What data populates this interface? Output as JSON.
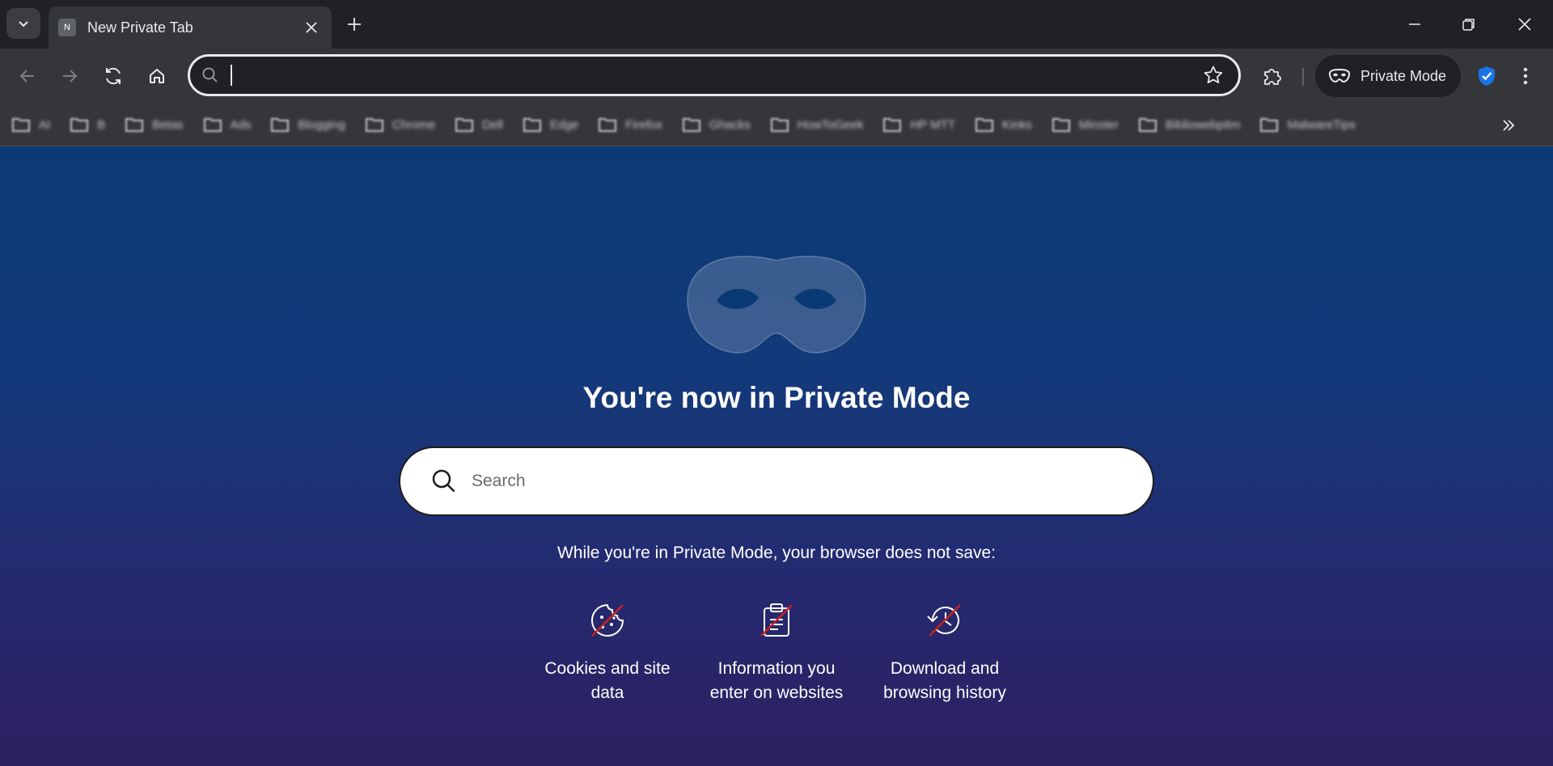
{
  "tab": {
    "favicon_letter": "N",
    "title": "New Private Tab"
  },
  "omnibox": {
    "value": "",
    "placeholder": ""
  },
  "toolbar": {
    "private_mode_label": "Private Mode"
  },
  "bookmarks": [
    {
      "label": "AI"
    },
    {
      "label": "B"
    },
    {
      "label": "Betas"
    },
    {
      "label": "Ads"
    },
    {
      "label": "Blogging"
    },
    {
      "label": "Chrome"
    },
    {
      "label": "Dell"
    },
    {
      "label": "Edge"
    },
    {
      "label": "Firefox"
    },
    {
      "label": "Ghacks"
    },
    {
      "label": "HowToGeek"
    },
    {
      "label": "HP MTT"
    },
    {
      "label": "Kinks"
    },
    {
      "label": "Minster"
    },
    {
      "label": "Bibliowebpitm"
    },
    {
      "label": "MalwareTips"
    }
  ],
  "main": {
    "headline": "You're now in Private Mode",
    "search_placeholder": "Search",
    "subtext": "While you're in Private Mode, your browser does not save:",
    "features": [
      {
        "icon": "cookie-crossed-icon",
        "line1": "Cookies and site",
        "line2": "data"
      },
      {
        "icon": "clipboard-crossed-icon",
        "line1": "Information you",
        "line2": "enter on websites"
      },
      {
        "icon": "history-crossed-icon",
        "line1": "Download and",
        "line2": "browsing history"
      }
    ]
  },
  "colors": {
    "accent_blue": "#1a73e8",
    "strike_red": "#c5221f",
    "bg_top": "#0a3a73",
    "bg_bottom": "#2c1f60"
  }
}
